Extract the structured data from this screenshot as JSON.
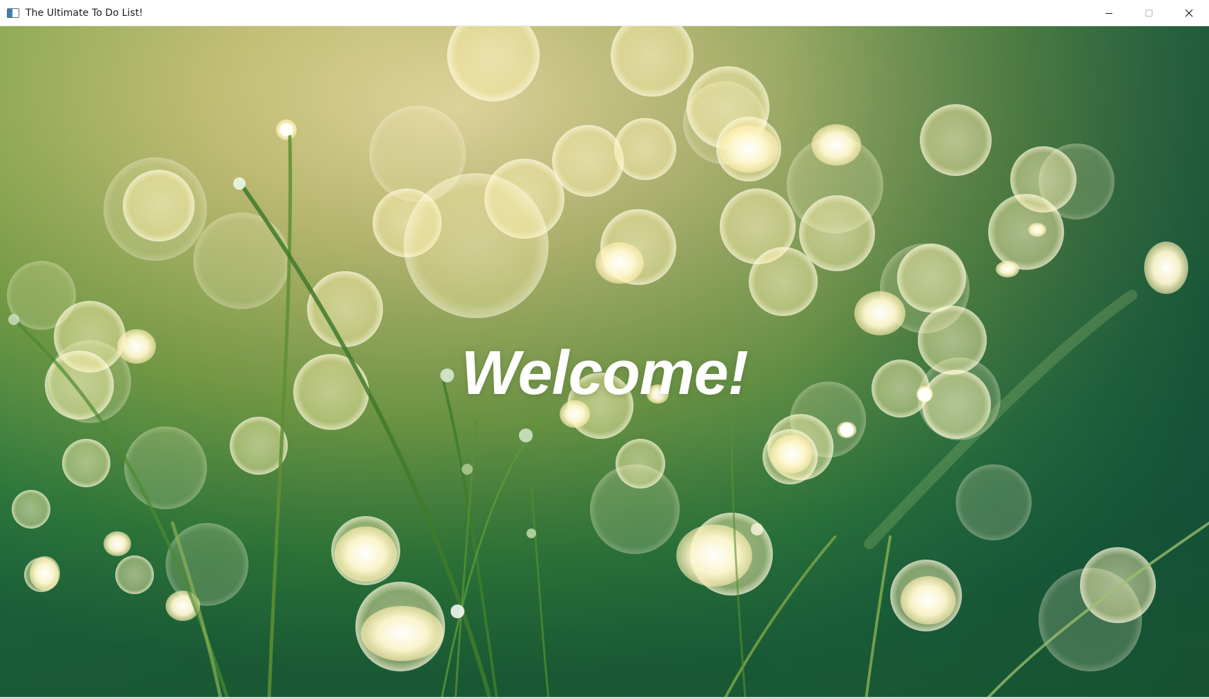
{
  "window": {
    "title": "The Ultimate To Do List!",
    "controls": {
      "minimize_icon": "minimize-icon",
      "maximize_icon": "maximize-icon",
      "close_icon": "close-icon"
    }
  },
  "main": {
    "welcome_text": "Welcome!",
    "background": "bokeh-grass-dew-image"
  },
  "colors": {
    "titlebar": "#ffffff",
    "welcome_text": "#ffffff",
    "background_dark": "#0f4a3c",
    "background_light": "#f5e3a0"
  }
}
